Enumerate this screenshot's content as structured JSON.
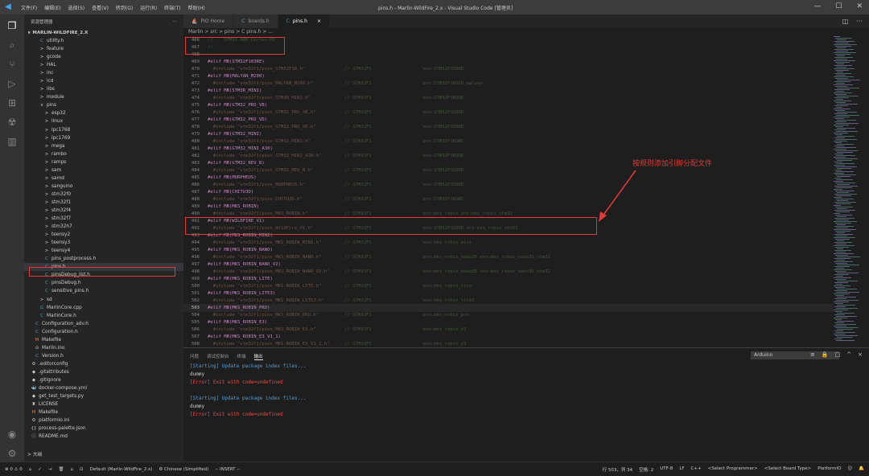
{
  "titlebar": {
    "logo": "◀",
    "menus": [
      "文件(F)",
      "编辑(E)",
      "选择(S)",
      "查看(V)",
      "转到(G)",
      "运行(R)",
      "终端(T)",
      "帮助(H)"
    ],
    "title": "pins.h - Marlin-WildFire_2.x - Visual Studio Code [管理员]"
  },
  "sidebar": {
    "header": "资源管理器",
    "header_more": "···",
    "root": "∨ MARLIN-WILDFIRE_2.X",
    "items": [
      {
        "label": "utility.h",
        "icon": "C",
        "indent": 10
      },
      {
        "label": "feature",
        "icon": ">",
        "indent": 10
      },
      {
        "label": "gcode",
        "icon": ">",
        "indent": 10
      },
      {
        "label": "HAL",
        "icon": ">",
        "indent": 10
      },
      {
        "label": "inc",
        "icon": ">",
        "indent": 10
      },
      {
        "label": "lcd",
        "icon": ">",
        "indent": 10
      },
      {
        "label": "libs",
        "icon": ">",
        "indent": 10
      },
      {
        "label": "module",
        "icon": ">",
        "indent": 10
      },
      {
        "label": "pins",
        "icon": "∨",
        "indent": 10
      },
      {
        "label": "esp32",
        "icon": ">",
        "indent": 16
      },
      {
        "label": "linux",
        "icon": ">",
        "indent": 16
      },
      {
        "label": "lpc1768",
        "icon": ">",
        "indent": 16
      },
      {
        "label": "lpc1769",
        "icon": ">",
        "indent": 16
      },
      {
        "label": "mega",
        "icon": ">",
        "indent": 16
      },
      {
        "label": "rambo",
        "icon": ">",
        "indent": 16
      },
      {
        "label": "ramps",
        "icon": ">",
        "indent": 16
      },
      {
        "label": "sam",
        "icon": ">",
        "indent": 16
      },
      {
        "label": "samd",
        "icon": ">",
        "indent": 16
      },
      {
        "label": "sanguino",
        "icon": ">",
        "indent": 16
      },
      {
        "label": "stm32f0",
        "icon": ">",
        "indent": 16
      },
      {
        "label": "stm32f1",
        "icon": ">",
        "indent": 16
      },
      {
        "label": "stm32f4",
        "icon": ">",
        "indent": 16
      },
      {
        "label": "stm32f7",
        "icon": ">",
        "indent": 16
      },
      {
        "label": "stm32h7",
        "icon": ">",
        "indent": 16
      },
      {
        "label": "teensy2",
        "icon": ">",
        "indent": 16
      },
      {
        "label": "teensy3",
        "icon": ">",
        "indent": 16
      },
      {
        "label": "teensy4",
        "icon": ">",
        "indent": 16
      },
      {
        "label": "pins_postprocess.h",
        "icon": "C",
        "indent": 16
      },
      {
        "label": "pins.h",
        "icon": "C",
        "indent": 16,
        "selected": true
      },
      {
        "label": "pinsDebug_list.h",
        "icon": "C",
        "indent": 16
      },
      {
        "label": "pinsDebug.h",
        "icon": "C",
        "indent": 16
      },
      {
        "label": "sensitive_pins.h",
        "icon": "C",
        "indent": 16
      },
      {
        "label": "sd",
        "icon": ">",
        "indent": 10
      },
      {
        "label": "MarlinCore.cpp",
        "icon": "G",
        "indent": 10
      },
      {
        "label": "MarlinCore.h",
        "icon": "C",
        "indent": 10
      },
      {
        "label": "Configuration_adv.h",
        "icon": "C",
        "indent": 4
      },
      {
        "label": "Configuration.h",
        "icon": "C",
        "indent": 4
      },
      {
        "label": "Makefile",
        "icon": "M",
        "indent": 4
      },
      {
        "label": "Marlin.ino",
        "icon": "⊙",
        "indent": 4
      },
      {
        "label": "Version.h",
        "icon": "C",
        "indent": 4
      },
      {
        "label": ".editorconfig",
        "icon": "⚙",
        "indent": 0
      },
      {
        "label": ".gitattributes",
        "icon": "◆",
        "indent": 0
      },
      {
        "label": ".gitignore",
        "icon": "◆",
        "indent": 0
      },
      {
        "label": "docker-compose.yml",
        "icon": "🐳",
        "indent": 0
      },
      {
        "label": "get_test_targets.py",
        "icon": "◆",
        "indent": 0
      },
      {
        "label": "LICENSE",
        "icon": "♜",
        "indent": 0
      },
      {
        "label": "Makefile",
        "icon": "M",
        "indent": 0
      },
      {
        "label": "platformio.ini",
        "icon": "⚙",
        "indent": 0
      },
      {
        "label": "process-palette.json",
        "icon": "{}",
        "indent": 0
      },
      {
        "label": "README.md",
        "icon": "ⓘ",
        "indent": 0
      }
    ],
    "outline": "> 大纲"
  },
  "tabs": [
    {
      "label": "PIO Home",
      "icon": "⛵",
      "active": false
    },
    {
      "label": "boards.h",
      "icon": "C",
      "active": false
    },
    {
      "label": "pins.h",
      "icon": "C",
      "active": true,
      "close": "×"
    }
  ],
  "tab_actions": [
    "◫",
    "···"
  ],
  "breadcrumb": "Marlin > src > pins > C pins.h > ...",
  "editor": {
    "cursor_line_number": "503",
    "lines": [
      {
        "n": "466",
        "code": "//",
        "cm": "STM32 ARM Cortex-M3",
        "dimcode": true
      },
      {
        "n": "467",
        "code": "//",
        "cm": "",
        "dimcode": true
      },
      {
        "n": "468",
        "code": "",
        "cm": ""
      },
      {
        "n": "469",
        "code": "#elif MB(STM32F103RE)",
        "cm": ""
      },
      {
        "n": "470",
        "code": "  #include \"stm32f1/pins_STM32F1R.h\"",
        "cm": "// STM32F1                   env:STM32F103RE"
      },
      {
        "n": "471",
        "code": "#elif MB(MALYAN_M200)",
        "cm": ""
      },
      {
        "n": "472",
        "code": "  #include \"stm32f1/pins_MALYAN_M200.h\"",
        "cm": "// STM32F1                   env:STM32F103CB_malyan"
      },
      {
        "n": "473",
        "code": "#elif MB(STM3R_MINI)",
        "cm": ""
      },
      {
        "n": "474",
        "code": "  #include \"stm32f1/pins_STM3R_MINI.h\"",
        "cm": "// STM32F1                   env:STM32F103RE"
      },
      {
        "n": "475",
        "code": "#elif MB(GTM32_PRO_VB)",
        "cm": ""
      },
      {
        "n": "476",
        "code": "  #include \"stm32f1/pins_GTM32_PRO_VB.h\"",
        "cm": "// STM32F1                   env:STM32F103RE"
      },
      {
        "n": "477",
        "code": "#elif MB(GTM32_PRO_VD)",
        "cm": ""
      },
      {
        "n": "478",
        "code": "  #include \"stm32f1/pins_GTM32_PRO_VD.h\"",
        "cm": "// STM32F1                   env:STM32F103RE"
      },
      {
        "n": "479",
        "code": "#elif MB(GTM32_MINI)",
        "cm": ""
      },
      {
        "n": "480",
        "code": "  #include \"stm32f1/pins_GTM32_MINI.h\"",
        "cm": "// STM32F1                   env:STM32F103RE"
      },
      {
        "n": "481",
        "code": "#elif MB(GTM32_MINI_A30)",
        "cm": ""
      },
      {
        "n": "482",
        "code": "  #include \"stm32f1/pins_GTM32_MINI_A30.h\"",
        "cm": "// STM32F1                   env:STM32F103RE"
      },
      {
        "n": "483",
        "code": "#elif MB(GTM32_REV_B)",
        "cm": ""
      },
      {
        "n": "484",
        "code": "  #include \"stm32f1/pins_GTM32_REV_B.h\"",
        "cm": "// STM32F1                   env:STM32F103RE"
      },
      {
        "n": "485",
        "code": "#elif MB(MORPHEUS)",
        "cm": ""
      },
      {
        "n": "486",
        "code": "  #include \"stm32f1/pins_MORPHEUS.h\"",
        "cm": "// STM32F1                   env:STM32F103RE"
      },
      {
        "n": "487",
        "code": "#elif MB(CHITU3D)",
        "cm": ""
      },
      {
        "n": "488",
        "code": "  #include \"stm32f1/pins_CHITU3D.h\"",
        "cm": "// STM32F1                   env:STM32F103RE"
      },
      {
        "n": "489",
        "code": "#elif MB(MKS_ROBIN)",
        "cm": ""
      },
      {
        "n": "490",
        "code": "  #include \"stm32f1/pins_MKS_ROBIN.h\"",
        "cm": "// STM32F1                   env:mks_robin env:mks_robin_stm32"
      },
      {
        "n": "491",
        "code": "#elif MB(WILDFIRE_V1)",
        "cm": ""
      },
      {
        "n": "492",
        "code": "  #include \"stm32f1/pins_WildFire_V1.h\"",
        "cm": "// STM32F1                   env:STM32F103RE env:mks_robin_stm32"
      },
      {
        "n": "493",
        "code": "#elif MB(MKS_ROBIN_MINI)",
        "cm": ""
      },
      {
        "n": "494",
        "code": "  #include \"stm32f1/pins_MKS_ROBIN_MINI.h\"",
        "cm": "// STM32F1                   env:mks_robin_mini"
      },
      {
        "n": "495",
        "code": "#elif MB(MKS_ROBIN_NANO)",
        "cm": ""
      },
      {
        "n": "496",
        "code": "  #include \"stm32f1/pins_MKS_ROBIN_NANO.h\"",
        "cm": "// STM32F1                   env:mks_robin_nano35 env:mks_robin_nano35_stm32"
      },
      {
        "n": "497",
        "code": "#elif MB(MKS_ROBIN_NANO_V2)",
        "cm": ""
      },
      {
        "n": "498",
        "code": "  #include \"stm32f1/pins_MKS_ROBIN_NANO_V2.h\"",
        "cm": "// STM32F1                   env:mks_robin_nano35 env:mks_robin_nano35_stm32"
      },
      {
        "n": "499",
        "code": "#elif MB(MKS_ROBIN_LITE)",
        "cm": ""
      },
      {
        "n": "500",
        "code": "  #include \"stm32f1/pins_MKS_ROBIN_LITE.h\"",
        "cm": "// STM32F1                   env:mks_robin_lite"
      },
      {
        "n": "501",
        "code": "#elif MB(MKS_ROBIN_LITE3)",
        "cm": ""
      },
      {
        "n": "502",
        "code": "  #include \"stm32f1/pins_MKS_ROBIN_LITE3.h\"",
        "cm": "// STM32F1                   env:mks_robin_lite3"
      },
      {
        "n": "503",
        "code": "#elif MB(MKS_ROBIN_PRO)",
        "cm": "",
        "cursor": true
      },
      {
        "n": "504",
        "code": "  #include \"stm32f1/pins_MKS_ROBIN_PRO.h\"",
        "cm": "// STM32F1                   env:mks_robin_pro"
      },
      {
        "n": "505",
        "code": "#elif MB(MKS_ROBIN_E3)",
        "cm": ""
      },
      {
        "n": "506",
        "code": "  #include \"stm32f1/pins_MKS_ROBIN_E3.h\"",
        "cm": "// STM32F1                   env:mks_robin_e3"
      },
      {
        "n": "507",
        "code": "#elif MB(MKS_ROBIN_E3_V1_1)",
        "cm": ""
      },
      {
        "n": "508",
        "code": "  #include \"stm32f1/pins_MKS_ROBIN_E3_V1_1.h\"",
        "cm": "// STM32F1                   env:mks_robin_e3"
      }
    ]
  },
  "annotation": {
    "text": "按规则添加引脚分配文件",
    "color": "#e53935"
  },
  "panel": {
    "tabs": [
      "问题",
      "调试控制台",
      "终端",
      "输出"
    ],
    "active_tab": "输出",
    "select_value": "Arduino",
    "icons": [
      "≡",
      "🔒",
      "□",
      "^",
      "×"
    ],
    "output": [
      {
        "text": "[Starting] Update package index files...",
        "color": "#569cd6"
      },
      {
        "text": "dummy",
        "color": "#cccccc"
      },
      {
        "text": "[Error] Exit with code=undefined",
        "color": "#f44747"
      },
      {
        "text": "",
        "color": "#cccccc"
      },
      {
        "text": "[Starting] Update package index files...",
        "color": "#569cd6"
      },
      {
        "text": "dummy",
        "color": "#cccccc"
      },
      {
        "text": "[Error] Exit with code=undefined",
        "color": "#f44747"
      }
    ]
  },
  "statusbar": {
    "left": [
      "⊗ 0 ⚠ 0",
      "⌂",
      "✓",
      "→",
      "🗑",
      "⌂",
      "⊡",
      "Default (Marlin-WildFire_2.x)",
      "⚙ Chinese (Simplified)",
      "-- INSERT --"
    ],
    "right": [
      "行 503，列 34",
      "空格: 2",
      "UTF-8",
      "LF",
      "C++",
      "<Select Programmer>",
      "<Select Board Type>",
      "PlatformIO",
      "☺",
      "🔔"
    ]
  }
}
